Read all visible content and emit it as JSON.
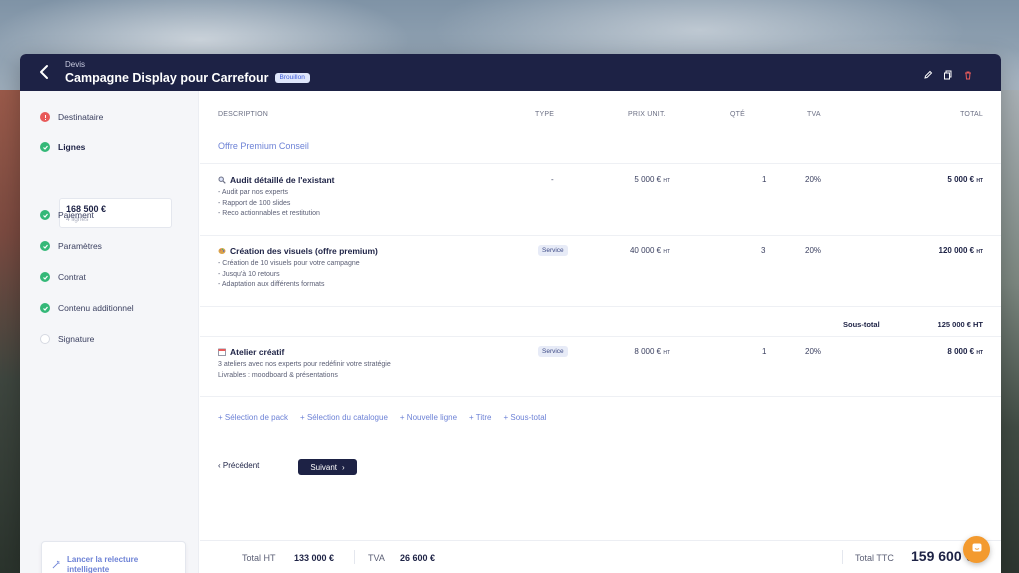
{
  "header": {
    "breadcrumb": "Devis",
    "title": "Campagne Display pour Carrefour",
    "status_badge": "Brouillon"
  },
  "sidebar": {
    "steps": [
      {
        "label": "Destinataire",
        "status": "error"
      },
      {
        "label": "Lignes",
        "status": "done"
      },
      {
        "label": "Paiement",
        "status": "done"
      },
      {
        "label": "Paramètres",
        "status": "done"
      },
      {
        "label": "Contrat",
        "status": "done"
      },
      {
        "label": "Contenu additionnel",
        "status": "done"
      },
      {
        "label": "Signature",
        "status": "todo"
      }
    ],
    "lines_card": {
      "amount": "168 500 €",
      "count": "4 lignes"
    },
    "relecture_label_1": "Lancer la relecture",
    "relecture_label_2": "intelligente"
  },
  "table": {
    "headers": {
      "description": "DESCRIPTION",
      "type": "TYPE",
      "unit_price": "PRIX UNIT.",
      "qty": "QTÉ",
      "vat": "TVA",
      "total": "TOTAL"
    },
    "section_title": "Offre Premium Conseil",
    "ht_suffix": "HT",
    "rows": [
      {
        "icon": "magnifier-icon",
        "name": "Audit détaillé de l'existant",
        "desc": [
          "- Audit par nos experts",
          "- Rapport de 100 slides",
          "- Reco actionnables et restitution"
        ],
        "type": "-",
        "unit_price": "5 000 €",
        "qty": "1",
        "vat": "20%",
        "total": "5 000 €"
      },
      {
        "icon": "palette-icon",
        "name": "Création des visuels (offre premium)",
        "desc": [
          "- Création de 10 visuels pour votre campagne",
          "- Jusqu'à 10 retours",
          "- Adaptation aux différents formats"
        ],
        "type": "Service",
        "unit_price": "40 000 €",
        "qty": "3",
        "vat": "20%",
        "total": "120 000 €"
      },
      {
        "icon": "calendar-icon",
        "name": "Atelier créatif",
        "desc": [
          "3 ateliers avec nos experts pour redéfinir votre stratégie",
          "Livrables : moodboard & présentations"
        ],
        "type": "Service",
        "unit_price": "8 000 €",
        "qty": "1",
        "vat": "20%",
        "total": "8 000 €"
      }
    ],
    "subtotal": {
      "label": "Sous-total",
      "value": "125 000 € HT"
    }
  },
  "actions": [
    "+ Sélection de pack",
    "+ Sélection du catalogue",
    "+ Nouvelle ligne",
    "+ Titre",
    "+ Sous-total"
  ],
  "nav": {
    "prev": "Précédent",
    "next": "Suivant"
  },
  "footer": {
    "total_ht_label": "Total HT",
    "total_ht_value": "133 000 €",
    "vat_label": "TVA",
    "vat_value": "26 600 €",
    "ttc_label": "Total TTC",
    "ttc_value": "159 600 €"
  },
  "colors": {
    "navy": "#1d2245",
    "accent": "#6d82d6",
    "success": "#34b878",
    "error": "#e85a5a",
    "chat": "#f39a2e"
  }
}
